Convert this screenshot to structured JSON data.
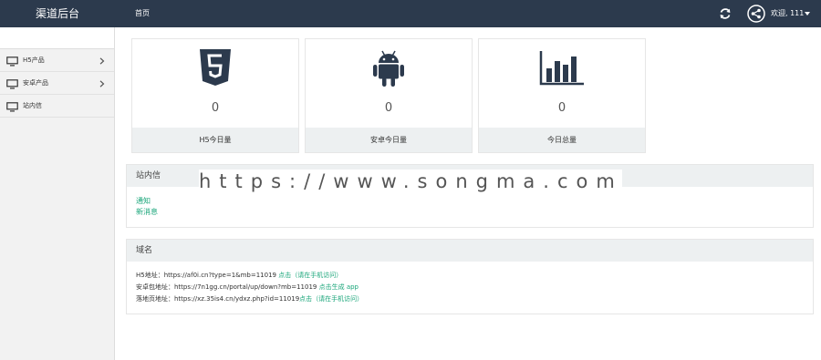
{
  "header": {
    "brand": "渠道后台",
    "nav_home": "首页",
    "user_greeting": "欢迎, 111",
    "icons": [
      "refresh-icon",
      "share-icon",
      "chevron-down-icon"
    ],
    "background": "#2c3a4d"
  },
  "sidebar": {
    "items": [
      {
        "label": "H5产品",
        "icon": "monitor-icon",
        "expandable": true
      },
      {
        "label": "安卓产品",
        "icon": "monitor-icon",
        "expandable": true
      },
      {
        "label": "站内信",
        "icon": "monitor-icon",
        "expandable": false
      }
    ]
  },
  "stats": [
    {
      "icon": "html5-icon",
      "value": "0",
      "label": "H5今日量"
    },
    {
      "icon": "android-icon",
      "value": "0",
      "label": "安卓今日量"
    },
    {
      "icon": "bar-chart-icon",
      "value": "0",
      "label": "今日总量"
    }
  ],
  "messages": {
    "title": "站内信",
    "items": [
      "通知",
      "新消息"
    ]
  },
  "domains": {
    "title": "域名",
    "rows": [
      {
        "label": "H5地址：",
        "url": "https://af0i.cn?type=1&mb=11019",
        "action": " 点击（请在手机访问）"
      },
      {
        "label": "安卓包地址：",
        "url": "https://7n1gg.cn/portal/up/down?mb=11019",
        "action": " 点击生成 app"
      },
      {
        "label": "落地页地址：",
        "url": "https://xz.35is4.cn/ydxz.php?id=11019",
        "action": "点击（请在手机访问）"
      }
    ]
  },
  "watermark": "https://www.songma.com",
  "colors": {
    "accent_green": "#1aa67a",
    "panel_header": "#edf0f1"
  }
}
